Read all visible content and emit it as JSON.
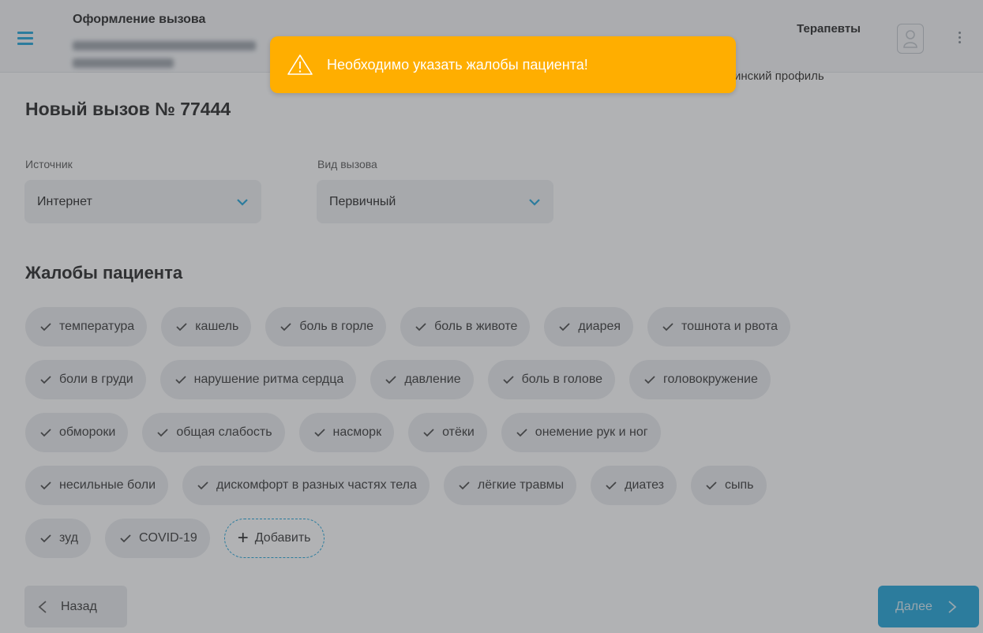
{
  "header": {
    "title": "Оформление вызова",
    "department": "Терапевты",
    "profile": "инский профиль"
  },
  "page": {
    "title": "Новый вызов № 77444"
  },
  "fields": {
    "source": {
      "label": "Источник",
      "value": "Интернет"
    },
    "call_type": {
      "label": "Вид вызова",
      "value": "Первичный"
    }
  },
  "complaints": {
    "title": "Жалобы пациента",
    "rows": [
      [
        "температура",
        "кашель",
        "боль в горле",
        "боль в животе",
        "диарея",
        "тошнота и рвота"
      ],
      [
        "боли в груди",
        "нарушение ритма сердца",
        "давление",
        "боль в голове",
        "головокружение"
      ],
      [
        "обмороки",
        "общая слабость",
        "насморк",
        "отёки",
        "онемение рук и ног"
      ],
      [
        "несильные боли",
        "дискомфорт в разных частях тела",
        "лёгкие травмы",
        "диатез",
        "сыпь"
      ],
      [
        "зуд",
        "COVID-19"
      ]
    ],
    "add_label": "Добавить"
  },
  "footer": {
    "back_label": "Назад",
    "next_label": "Далее"
  },
  "toast": {
    "message": "Необходимо указать жалобы пациента!",
    "icon": "warning-icon",
    "color": "#ffae00"
  },
  "colors": {
    "accent": "#1aa3d8",
    "overlay": "rgba(70,72,76,0.42)"
  }
}
